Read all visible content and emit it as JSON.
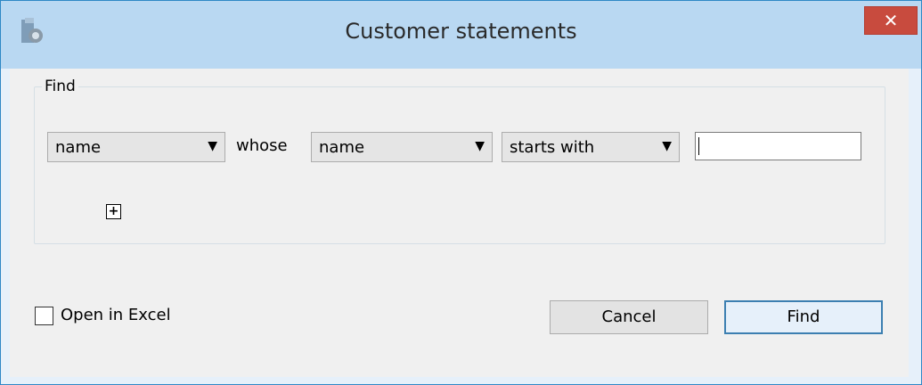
{
  "window": {
    "title": "Customer statements",
    "close_glyph": "✕",
    "app_icon": "app-logo-icon"
  },
  "find_group": {
    "label": "Find",
    "field_select": {
      "value": "name"
    },
    "connector": "whose",
    "property_select": {
      "value": "name"
    },
    "operator_select": {
      "value": "starts with"
    },
    "search_value": "",
    "add_criteria_glyph": "+"
  },
  "options": {
    "open_in_excel_label": "Open in Excel",
    "open_in_excel_checked": false
  },
  "buttons": {
    "cancel_label": "Cancel",
    "find_label": "Find"
  },
  "colors": {
    "titlebar": "#b9d8f2",
    "close_button": "#c84b3e",
    "default_button_border": "#3c7fb1"
  }
}
